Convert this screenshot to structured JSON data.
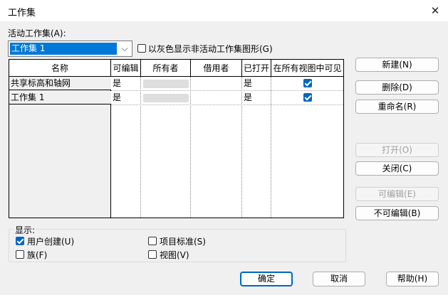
{
  "window": {
    "title": "工作集",
    "close_icon": "✕"
  },
  "active_workset": {
    "label": "活动工作集(A):",
    "value": "工作集 1",
    "gray_checkbox_label": "以灰色显示非活动工作集图形(G)",
    "gray_checked": false
  },
  "table": {
    "columns": [
      "名称",
      "可编辑",
      "所有者",
      "借用者",
      "已打开",
      "在所有视图中可见"
    ],
    "rows": [
      {
        "name": "共享标高和轴网",
        "editable": "是",
        "opened": "是",
        "visible": true
      },
      {
        "name": "工作集 1",
        "editable": "是",
        "opened": "是",
        "visible": true
      }
    ]
  },
  "side_buttons": {
    "new": "新建(N)",
    "delete": "删除(D)",
    "rename": "重命名(R)",
    "open": "打开(O)",
    "close": "关闭(C)",
    "editable": "可编辑(E)",
    "non_editable": "不可编辑(B)"
  },
  "show": {
    "label": "显示:",
    "user_created": {
      "label": "用户创建(U)",
      "checked": true
    },
    "families": {
      "label": "族(F)",
      "checked": false
    },
    "project_standards": {
      "label": "项目标准(S)",
      "checked": false
    },
    "views": {
      "label": "视图(V)",
      "checked": false
    }
  },
  "footer": {
    "ok": "确定",
    "cancel": "取消",
    "help": "帮助(H)"
  }
}
